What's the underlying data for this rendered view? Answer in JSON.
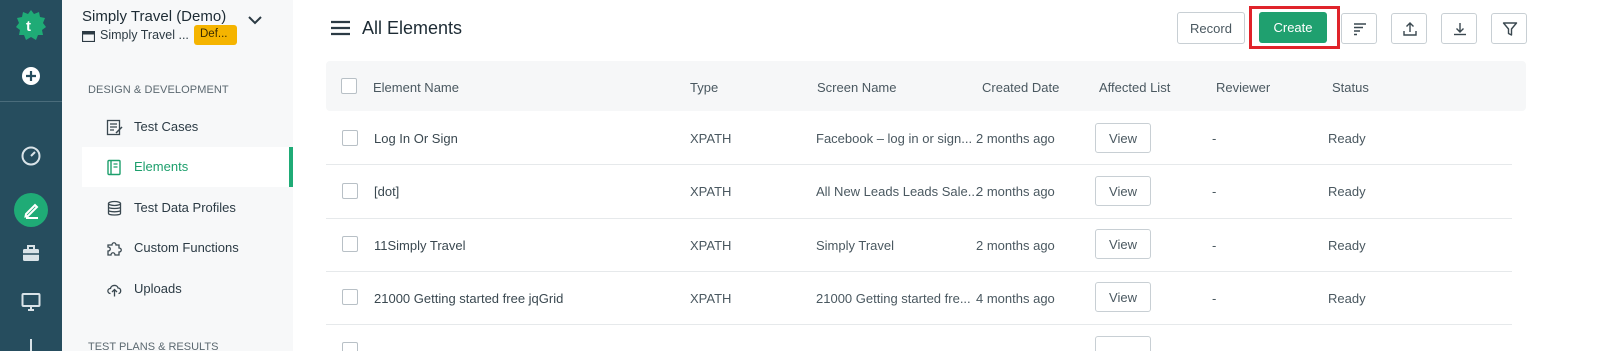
{
  "sidebar": {
    "workspace_title": "Simply Travel (Demo)",
    "workspace_sub": "Simply Travel ...",
    "workspace_badge": "Def...",
    "section_design": "DESIGN & DEVELOPMENT",
    "section_next": "TEST PLANS & RESULTS",
    "items": [
      {
        "label": "Test Cases",
        "icon": "test-cases-icon"
      },
      {
        "label": "Elements",
        "icon": "elements-icon",
        "active": true
      },
      {
        "label": "Test Data Profiles",
        "icon": "database-icon"
      },
      {
        "label": "Custom Functions",
        "icon": "puzzle-icon"
      },
      {
        "label": "Uploads",
        "icon": "cloud-upload-icon"
      }
    ]
  },
  "header": {
    "title": "All Elements",
    "record_label": "Record",
    "create_label": "Create"
  },
  "table": {
    "columns": [
      "Element Name",
      "Type",
      "Screen Name",
      "Created Date",
      "Affected List",
      "Reviewer",
      "Status"
    ],
    "rows": [
      {
        "name": "Log In Or Sign",
        "type": "XPATH",
        "screen": "Facebook – log in or sign...",
        "created": "2 months ago",
        "affected": "View",
        "reviewer": "-",
        "status": "Ready"
      },
      {
        "name": "[dot]",
        "type": "XPATH",
        "screen": "All New Leads Leads Sale...",
        "created": "2 months ago",
        "affected": "View",
        "reviewer": "-",
        "status": "Ready"
      },
      {
        "name": "11Simply Travel",
        "type": "XPATH",
        "screen": "Simply Travel",
        "created": "2 months ago",
        "affected": "View",
        "reviewer": "-",
        "status": "Ready"
      },
      {
        "name": "21000 Getting started free jqGrid",
        "type": "XPATH",
        "screen": "21000 Getting started fre...",
        "created": "4 months ago",
        "affected": "View",
        "reviewer": "-",
        "status": "Ready"
      }
    ]
  },
  "colors": {
    "rail_bg": "#264d5e",
    "accent_green": "#1fab76",
    "highlight_red": "#e0232a",
    "badge_yellow": "#f5b400"
  }
}
